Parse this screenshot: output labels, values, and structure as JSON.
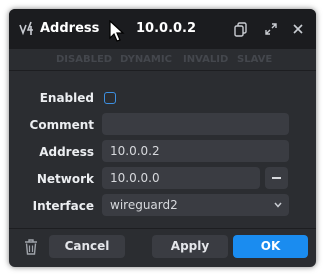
{
  "window": {
    "title": "Address",
    "title_value": "10.0.0.2",
    "app_icon": "winbox-logo-icon",
    "buttons": [
      "copy-icon",
      "restore-icon",
      "close-icon"
    ]
  },
  "flags": [
    "DISABLED",
    "DYNAMIC",
    "INVALID",
    "SLAVE"
  ],
  "form": {
    "enabled_label": "Enabled",
    "enabled_checked": false,
    "comment_label": "Comment",
    "comment_value": "",
    "address_label": "Address",
    "address_value": "10.0.0.2",
    "network_label": "Network",
    "network_value": "10.0.0.0",
    "network_remove_symbol": "−",
    "interface_label": "Interface",
    "interface_value": "wireguard2"
  },
  "footer": {
    "delete_icon": "trash-icon",
    "cancel_label": "Cancel",
    "apply_label": "Apply",
    "ok_label": "OK"
  },
  "colors": {
    "background": "#2b2d31",
    "titlebar": "#1b1c1f",
    "field": "#3a3c42",
    "accent": "#1a8cf0",
    "checkbox_border": "#3d8fe0",
    "flag_text": "#44474d"
  }
}
